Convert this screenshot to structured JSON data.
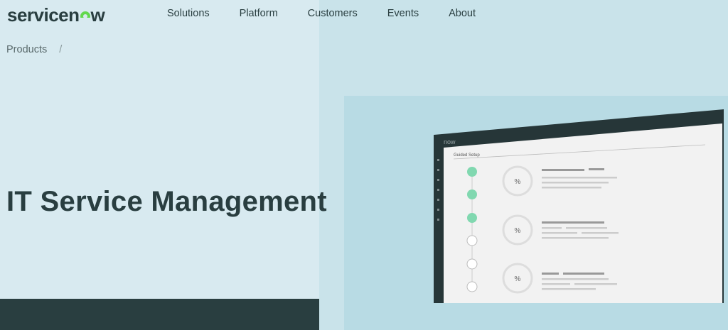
{
  "header": {
    "logo_text_start": "servicen",
    "logo_text_end": "w",
    "nav": [
      {
        "label": "Solutions"
      },
      {
        "label": "Platform"
      },
      {
        "label": "Customers"
      },
      {
        "label": "Events"
      },
      {
        "label": "About"
      }
    ]
  },
  "breadcrumb": {
    "items": [
      {
        "label": "Products"
      }
    ],
    "separator": "/"
  },
  "hero": {
    "title": "IT Service Management"
  },
  "mockup": {
    "brand": "now",
    "panel_title": "Guided Setup",
    "percent_symbol": "%",
    "steps": [
      {
        "completed": true
      },
      {
        "completed": true
      },
      {
        "completed": true
      },
      {
        "completed": false
      },
      {
        "completed": false
      },
      {
        "completed": false
      }
    ]
  },
  "colors": {
    "brand_dark": "#293e40",
    "brand_green": "#62d84e",
    "check_green": "#81d8b0"
  }
}
